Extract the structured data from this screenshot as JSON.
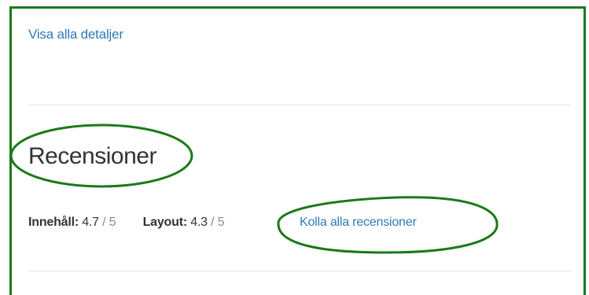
{
  "details": {
    "show_all_label": "Visa alla detaljer"
  },
  "reviews": {
    "heading": "Recensioner",
    "content_rating": {
      "label": "Innehåll:",
      "score": "4.7",
      "max": " / 5"
    },
    "layout_rating": {
      "label": "Layout:",
      "score": "4.3",
      "max": " / 5"
    },
    "all_reviews_label": "Kolla alla recensioner"
  },
  "colors": {
    "link": "#2e7ab8",
    "annotation": "#1a7a1a",
    "text": "#333333",
    "muted": "#8a8a8a"
  }
}
